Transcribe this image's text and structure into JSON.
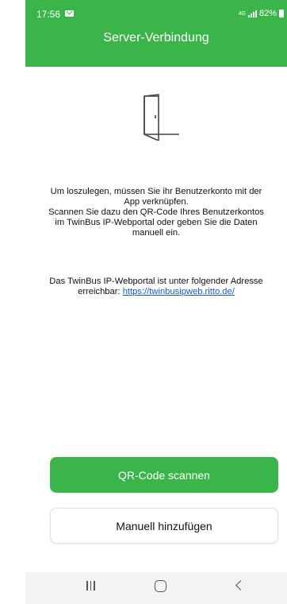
{
  "status_bar": {
    "time": "17:56",
    "network": "4G",
    "battery": "82%"
  },
  "header": {
    "title": "Server-Verbindung"
  },
  "content": {
    "intro_line1": "Um loszulegen, müssen Sie ihr Benutzerkonto mit der",
    "intro_line2": "App verknüpfen.",
    "intro_line3": "Scannen Sie dazu den QR-Code Ihres Benutzerkontos",
    "intro_line4": "im TwinBus IP-Webportal oder geben Sie die Daten",
    "intro_line5": "manuell ein.",
    "portal_line1": "Das TwinBus IP-Webportal ist unter folgender Adresse",
    "portal_line2_prefix": "erreichbar: ",
    "portal_url": "https://twinbusipweb.ritto.de/"
  },
  "buttons": {
    "scan_qr": "QR-Code scannen",
    "manual_add": "Manuell hinzufügen"
  },
  "colors": {
    "accent": "#3bb54a",
    "link": "#1a55cc"
  },
  "icons": {
    "door": "door-icon",
    "nav_recent": "recent-apps-icon",
    "nav_home": "home-icon",
    "nav_back": "back-icon"
  }
}
